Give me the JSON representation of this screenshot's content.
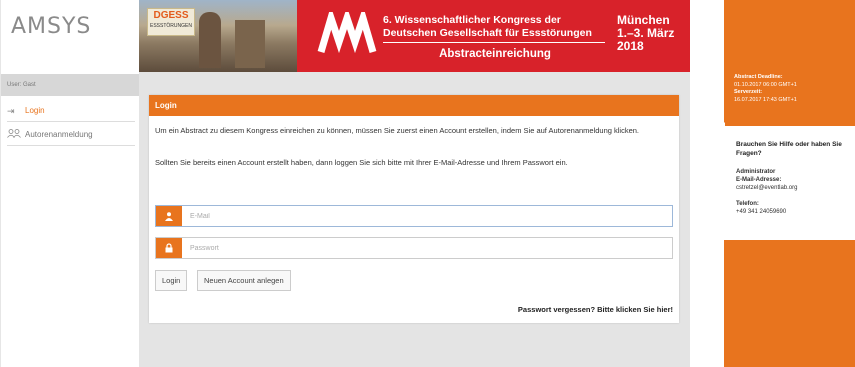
{
  "app": {
    "logo": "AMSYS",
    "user_label": "User: Gast"
  },
  "sidebar": {
    "items": [
      {
        "label": "Login",
        "icon": "login-arrow-icon"
      },
      {
        "label": "Autorenanmeldung",
        "icon": "users-icon"
      }
    ]
  },
  "banner": {
    "org": "DGESS",
    "org_sub": "ESSSTÖRUNGEN",
    "title_line1": "6. Wissenschaftlicher Kongress der",
    "title_line2": "Deutschen Gesellschaft für Essstörungen",
    "subtitle": "Abstracteinreichung",
    "city": "München",
    "dates": "1.–3. März",
    "year": "2018"
  },
  "login": {
    "header": "Login",
    "intro1": "Um ein Abstract zu diesem Kongress einreichen zu können, müssen Sie zuerst einen Account erstellen, indem Sie auf Autorenanmeldung klicken.",
    "intro2": "Sollten Sie bereits einen Account erstellt haben, dann loggen Sie sich bitte mit Ihrer E-Mail-Adresse und Ihrem Passwort ein.",
    "email_placeholder": "E-Mail",
    "password_placeholder": "Passwort",
    "login_button": "Login",
    "new_account_button": "Neuen Account anlegen",
    "forgot": "Passwort vergessen? Bitte klicken Sie hier!"
  },
  "right": {
    "deadline_label": "Abstract Deadline:",
    "deadline_value": "01.10.2017 06:00 GMT+1",
    "servertime_label": "Serverzeit:",
    "servertime_value": "16.07.2017 17:43 GMT+1",
    "help_question": "Brauchen Sie Hilfe oder haben Sie Fragen?",
    "admin_label": "Administrator",
    "email_label": "E-Mail-Adresse:",
    "email_value": "cstretzel@eventlab.org",
    "phone_label": "Telefon:",
    "phone_value": "+49 341 24059690"
  },
  "colors": {
    "accent": "#e8741e",
    "banner_red": "#d8222a"
  }
}
